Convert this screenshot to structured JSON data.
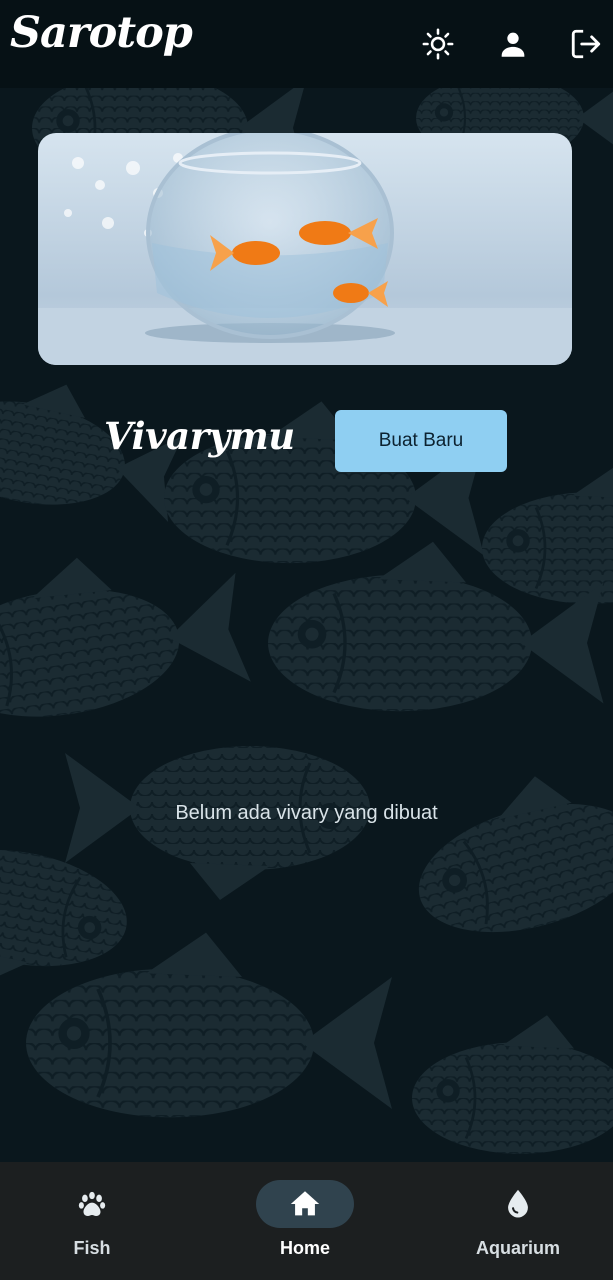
{
  "app": {
    "title": "Sarotop"
  },
  "header": {
    "actions": [
      {
        "id": "theme",
        "icon": "sun-icon"
      },
      {
        "id": "profile",
        "icon": "person-icon"
      },
      {
        "id": "logout",
        "icon": "logout-icon"
      }
    ]
  },
  "main": {
    "section_title": "Vivarymu",
    "create_button_label": "Buat Baru",
    "empty_message": "Belum ada vivary yang dibuat"
  },
  "nav": {
    "items": [
      {
        "label": "Fish",
        "icon": "paw-icon",
        "active": false
      },
      {
        "label": "Home",
        "icon": "home-icon",
        "active": true
      },
      {
        "label": "Aquarium",
        "icon": "water-drop-icon",
        "active": false
      }
    ]
  },
  "colors": {
    "appbar_bg": "#061115",
    "page_bg": "#0a171d",
    "pattern_fish": "#1b2b32",
    "button_bg": "#8fcff2",
    "nav_bg": "#1c1f20",
    "nav_active_pill": "#30434e"
  }
}
